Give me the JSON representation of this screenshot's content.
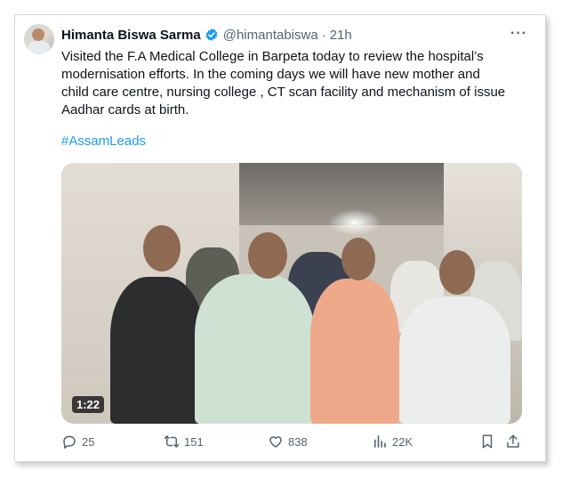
{
  "tweet": {
    "author_name": "Himanta Biswa Sarma",
    "handle": "@himantabiswa",
    "separator": "·",
    "time": "21h",
    "more_label": "···",
    "text": "Visited the F.A Medical College in Barpeta today to review the hospital’s\nmodernisation efforts. In the coming days we will have new mother and\nchild care centre, nursing college , CT scan facility and mechanism of issue\nAadhar cards at birth.",
    "hashtag": "#AssamLeads",
    "video_duration": "1:22"
  },
  "stats": {
    "replies": "25",
    "retweets": "151",
    "likes": "838",
    "views": "22K"
  },
  "icons": {
    "verified": "verified-badge-icon",
    "reply": "reply-icon",
    "retweet": "retweet-icon",
    "like": "heart-icon",
    "views": "views-icon",
    "bookmark": "bookmark-icon",
    "share": "share-icon"
  },
  "colors": {
    "text": "#0f1419",
    "muted": "#536471",
    "link": "#1d9bf0",
    "verified": "#1d9bf0"
  }
}
